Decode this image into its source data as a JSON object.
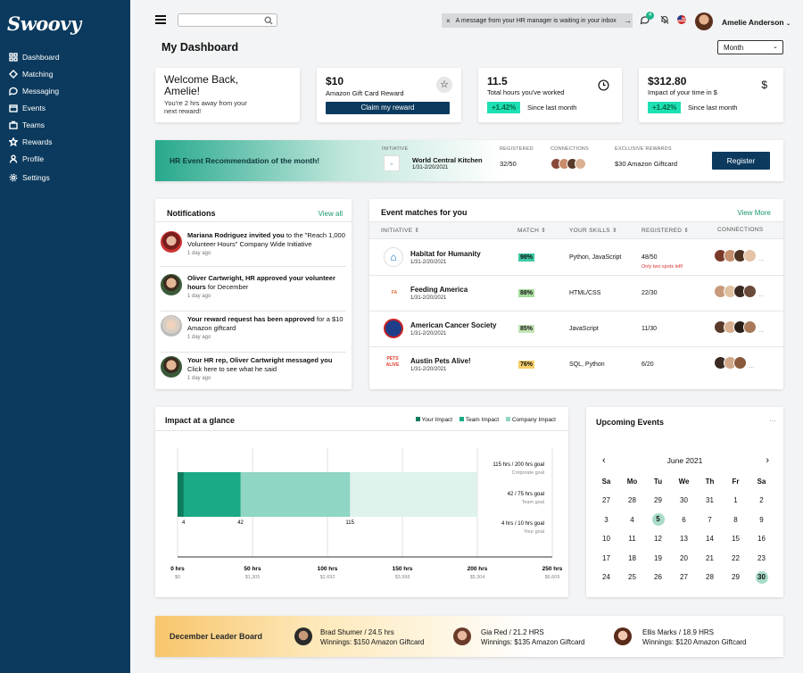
{
  "app": {
    "logo": "Swoovy"
  },
  "sidebar": {
    "items": [
      {
        "label": "Dashboard",
        "icon": "grid-icon"
      },
      {
        "label": "Matching",
        "icon": "matching-icon"
      },
      {
        "label": "Messaging",
        "icon": "chat-icon"
      },
      {
        "label": "Events",
        "icon": "calendar-icon"
      },
      {
        "label": "Teams",
        "icon": "teams-icon"
      },
      {
        "label": "Rewards",
        "icon": "star-icon"
      },
      {
        "label": "Profile",
        "icon": "user-icon"
      },
      {
        "label": "Settings",
        "icon": "gear-icon"
      }
    ]
  },
  "header": {
    "toast": "A message from your HR manager is waiting in your inbox",
    "chat_badge": "4",
    "user_name": "Amelie Anderson",
    "page_title": "My Dashboard",
    "period": "Month"
  },
  "stats": {
    "welcome_title": "Welcome Back, Amelie!",
    "welcome_sub": "You're 2 hrs away from your next reward!",
    "reward_value": "$10",
    "reward_name": "Amazon Gift Card Reward",
    "reward_button": "Claim my reward",
    "hours_value": "11.5",
    "hours_label": "Total hours you've worked",
    "hours_change": "+1.42%",
    "hours_since": "Since last month",
    "impact_value": "$312.80",
    "impact_label": "Impact of your time in $",
    "impact_change": "+1.42%",
    "impact_since": "Since last month"
  },
  "recommendation": {
    "title": "HR Event Recommendation of the month!",
    "initiative_label": "INITIATIVE",
    "initiative_name": "World Central Kitchen",
    "initiative_dates": "1/31-2/20/2021",
    "registered_label": "REGISTERED",
    "registered": "32/50",
    "connections_label": "CONNECTIONS",
    "rewards_label": "EXCLUSIVE REWARDS",
    "reward": "$30 Amazon Giftcard",
    "button": "Register"
  },
  "notifications": {
    "title": "Notifications",
    "view_all": "View all",
    "items": [
      {
        "bold": "Mariana Rodriguez invited you",
        "text": " to the \"Reach 1,000 Volunteer Hours\" Company Wide Initiative",
        "ago": "1 day ago"
      },
      {
        "bold": "Oliver Cartwright, HR approved your volunteer hours",
        "text": " for December",
        "ago": "1 day ago"
      },
      {
        "bold": "Your reward request has been approved",
        "text": " for a $10 Amazon giftcard",
        "ago": "1 day ago"
      },
      {
        "bold": "Your HR rep, Oliver Cartwright messaged you",
        "text": " Click here to see what he said",
        "ago": "1 day ago"
      }
    ]
  },
  "matches": {
    "title": "Event matches for you",
    "view_more": "View More",
    "headers": {
      "initiative": "INITIATIVE ⇕",
      "match": "MATCH ⇕",
      "skills": "YOUR SKILLS ⇕",
      "registered": "REGISTERED ⇕",
      "connections": "CONNECTIONS"
    },
    "rows": [
      {
        "name": "Habitat for Humanity",
        "dates": "1/31-2/20/2021",
        "match": "98%",
        "skills": "Python, JavaScript",
        "registered": "48/50",
        "note": "Only two spots left!",
        "match_color": "#3fc9a3"
      },
      {
        "name": "Feeding America",
        "dates": "1/31-2/20/2021",
        "match": "88%",
        "skills": "HTML/CSS",
        "registered": "22/30",
        "note": "",
        "match_color": "#a8dca0"
      },
      {
        "name": "American Cancer Society",
        "dates": "1/31-2/20/2021",
        "match": "85%",
        "skills": "JavaScript",
        "registered": "11/30",
        "note": "",
        "match_color": "#c3e4b4"
      },
      {
        "name": "Austin Pets Alive!",
        "dates": "1/31-2/20/2021",
        "match": "76%",
        "skills": "SQL, Python",
        "registered": "6/20",
        "note": "",
        "match_color": "#f7cf6a"
      }
    ]
  },
  "impact": {
    "title": "Impact at a glance",
    "legend": [
      {
        "label": "Your Impact",
        "color": "#0e7c5f"
      },
      {
        "label": "Team Impact",
        "color": "#1aaa85"
      },
      {
        "label": "Company Impact",
        "color": "#8fd6c4"
      }
    ],
    "goals": [
      {
        "text": "115 hrs / 200 hrs goal",
        "sub": "Corporate goal"
      },
      {
        "text": "42 / 75 hrs goal",
        "sub": "Team goal"
      },
      {
        "text": "4 hrs / 10 hrs goal",
        "sub": "Your goal"
      }
    ]
  },
  "chart_data": {
    "type": "bar",
    "orientation": "horizontal-stacked",
    "series": [
      {
        "name": "Your Impact",
        "value": 4
      },
      {
        "name": "Team Impact",
        "value": 42
      },
      {
        "name": "Company Impact",
        "value": 115
      }
    ],
    "x_ticks": [
      {
        "label": "0 hrs",
        "sub": "$0"
      },
      {
        "label": "50 hrs",
        "sub": "$1,305"
      },
      {
        "label": "100 hrs",
        "sub": "$2,692"
      },
      {
        "label": "150 hrs",
        "sub": "$3,998"
      },
      {
        "label": "200 hrs",
        "sub": "$5,304"
      },
      {
        "label": "250 hrs",
        "sub": "$6,609"
      }
    ],
    "xlim": [
      0,
      250
    ],
    "goal_extent": 200
  },
  "calendar": {
    "title": "Upcoming Events",
    "month": "June 2021",
    "days": [
      "Sa",
      "Mo",
      "Tu",
      "We",
      "Th",
      "Fr",
      "Sa"
    ],
    "weeks": [
      [
        "27",
        "28",
        "29",
        "30",
        "31",
        "1",
        "2"
      ],
      [
        "3",
        "4",
        "5",
        "6",
        "7",
        "8",
        "9"
      ],
      [
        "10",
        "11",
        "12",
        "13",
        "14",
        "15",
        "16"
      ],
      [
        "17",
        "18",
        "19",
        "20",
        "21",
        "22",
        "23"
      ],
      [
        "24",
        "25",
        "26",
        "27",
        "28",
        "29",
        "30"
      ]
    ],
    "highlighted": [
      "5",
      "30"
    ]
  },
  "leaderboard": {
    "title": "December Leader Board",
    "entries": [
      {
        "name": "Brad Shumer / 24.5 hrs",
        "winnings": "Winnings: $150 Amazon Giftcard"
      },
      {
        "name": "Gia Red / 21.2 HRS",
        "winnings": "Winnings: $135 Amazon Giftcard"
      },
      {
        "name": "Ellis Marks / 18.9 HRS",
        "winnings": "Winnings: $120 Amazon Giftcard"
      }
    ]
  }
}
